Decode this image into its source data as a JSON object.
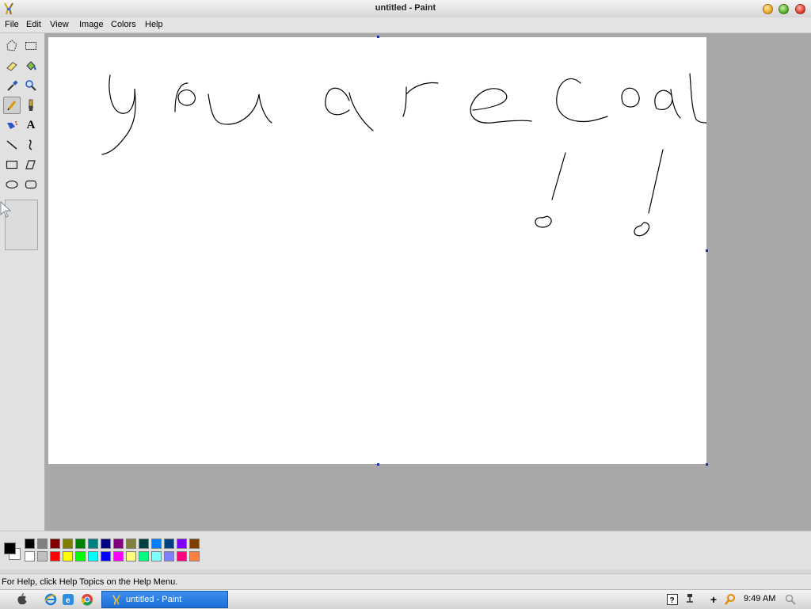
{
  "window": {
    "title": "untitled - Paint"
  },
  "menu": {
    "items": [
      "File",
      "Edit",
      "View",
      "Image",
      "Colors",
      "Help"
    ]
  },
  "toolbox": {
    "tools": [
      "free-form-select",
      "rectangle-select",
      "eraser",
      "fill-bucket",
      "color-picker",
      "magnifier",
      "pencil",
      "brush",
      "airbrush",
      "text",
      "line",
      "curve",
      "rectangle",
      "polygon",
      "ellipse",
      "rounded-rectangle"
    ],
    "selected": "pencil",
    "text_tool_glyph": "A"
  },
  "canvas": {
    "background": "#ffffff",
    "drawing_description_visible_as_strokes": true
  },
  "palette": {
    "foreground": "#000000",
    "background": "#ffffff",
    "row1": [
      "#000000",
      "#808080",
      "#800000",
      "#808000",
      "#008000",
      "#008080",
      "#000080",
      "#800080",
      "#808040",
      "#004040",
      "#0080ff",
      "#004080",
      "#8000ff",
      "#804000"
    ],
    "row2": [
      "#ffffff",
      "#c0c0c0",
      "#ff0000",
      "#ffff00",
      "#00ff00",
      "#00ffff",
      "#0000ff",
      "#ff00ff",
      "#ffff80",
      "#00ff80",
      "#80ffff",
      "#8080ff",
      "#ff0080",
      "#ff8040"
    ]
  },
  "statusbar": {
    "text": "For Help, click Help Topics on the Help Menu."
  },
  "taskbar": {
    "task_label": "untitled - Paint",
    "clock": "9:49 AM",
    "tray_plus": "+"
  }
}
